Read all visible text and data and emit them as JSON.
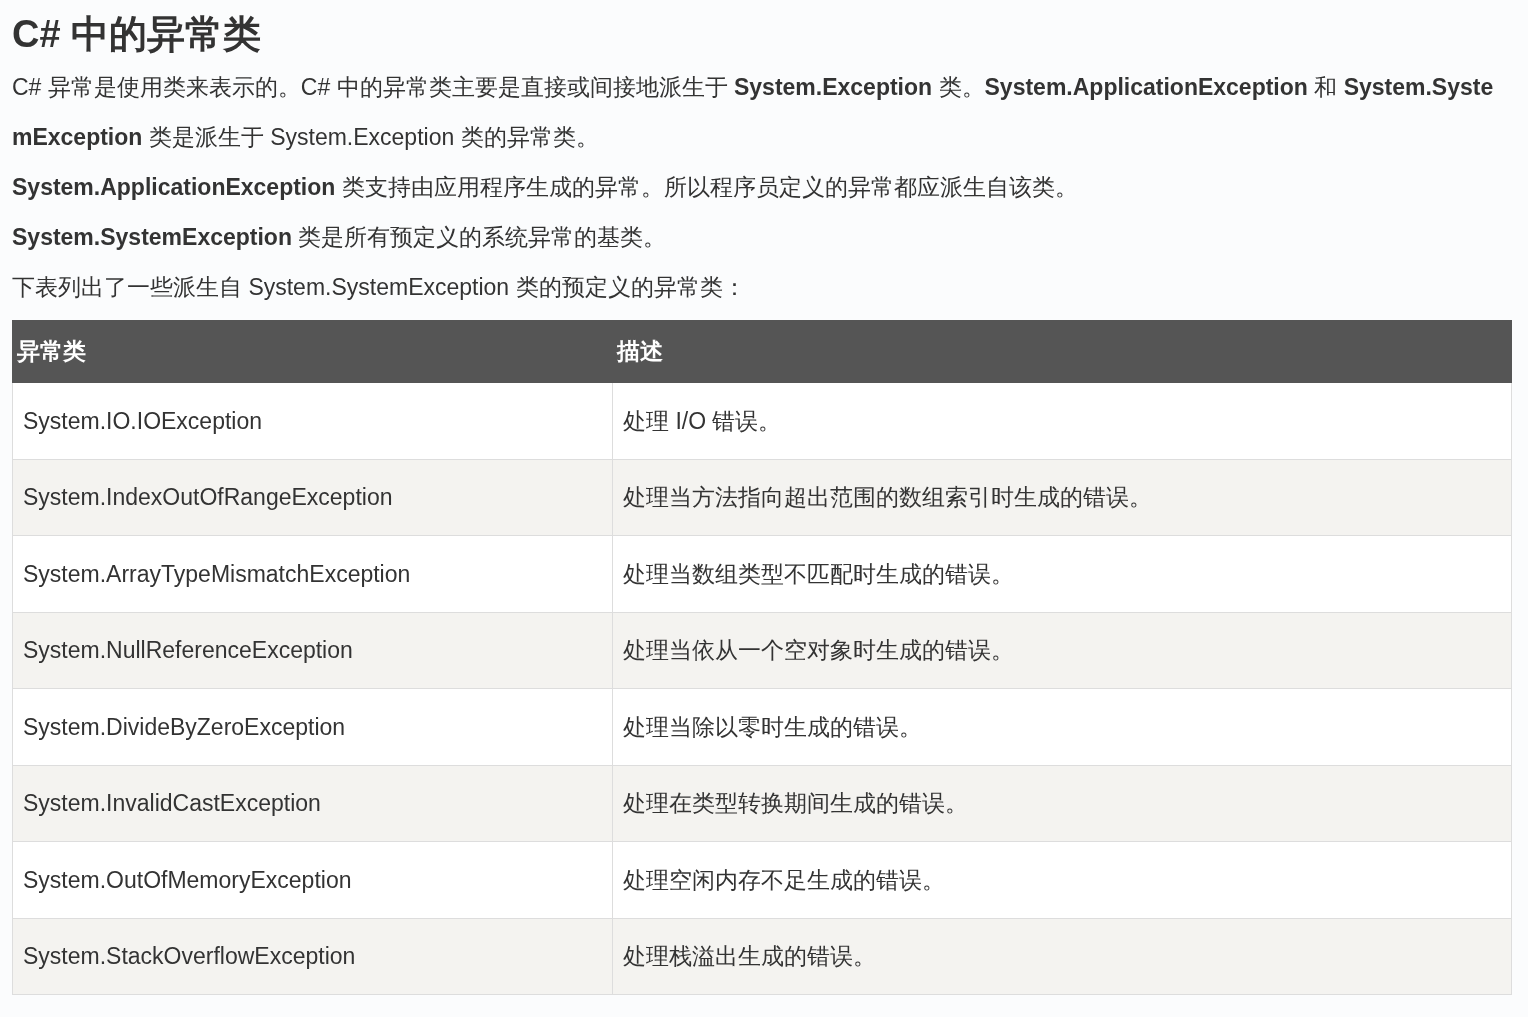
{
  "heading": "C# 中的异常类",
  "paragraphs": [
    "C# 异常是使用类来表示的。C# 中的异常类主要是直接或间接地派生于 **System.Exception** 类。**System.ApplicationException** 和 **System.SystemException** 类是派生于 System.Exception 类的异常类。",
    "**System.ApplicationException** 类支持由应用程序生成的异常。所以程序员定义的异常都应派生自该类。",
    "**System.SystemException** 类是所有预定义的系统异常的基类。",
    "下表列出了一些派生自 System.SystemException 类的预定义的异常类："
  ],
  "table": {
    "columns": [
      "异常类",
      "描述"
    ],
    "rows": [
      [
        "System.IO.IOException",
        "处理 I/O 错误。"
      ],
      [
        "System.IndexOutOfRangeException",
        "处理当方法指向超出范围的数组索引时生成的错误。"
      ],
      [
        "System.ArrayTypeMismatchException",
        "处理当数组类型不匹配时生成的错误。"
      ],
      [
        "System.NullReferenceException",
        "处理当依从一个空对象时生成的错误。"
      ],
      [
        "System.DivideByZeroException",
        "处理当除以零时生成的错误。"
      ],
      [
        "System.InvalidCastException",
        "处理在类型转换期间生成的错误。"
      ],
      [
        "System.OutOfMemoryException",
        "处理空闲内存不足生成的错误。"
      ],
      [
        "System.StackOverflowException",
        "处理栈溢出生成的错误。"
      ]
    ]
  }
}
